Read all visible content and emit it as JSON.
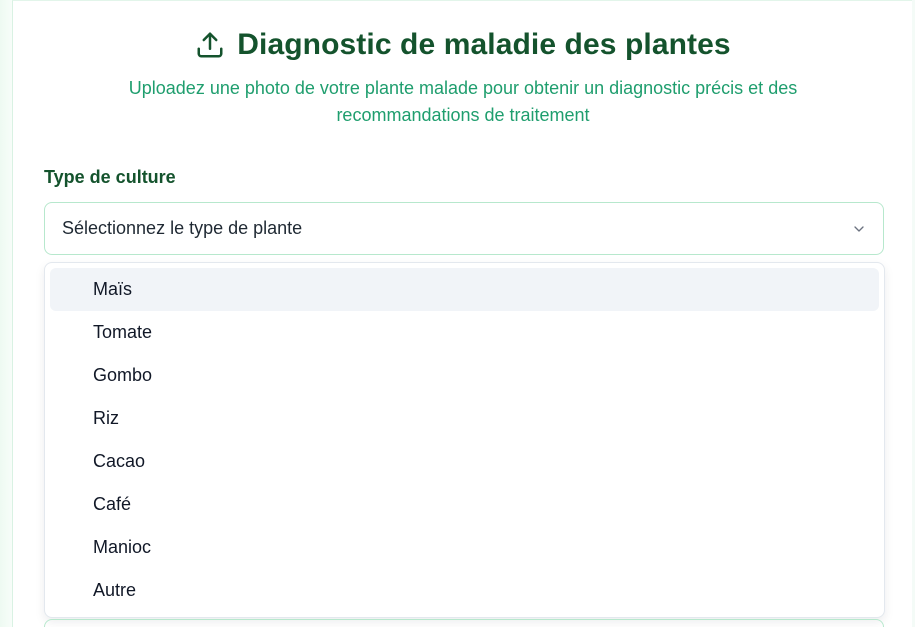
{
  "header": {
    "icon": "upload-icon",
    "title": "Diagnostic de maladie des plantes",
    "subtitle": "Uploadez une photo de votre plante malade pour obtenir un diagnostic précis et des recommandations de traitement"
  },
  "form": {
    "culture_label": "Type de culture",
    "culture_select": {
      "placeholder": "Sélectionnez le type de plante",
      "icon": "chevron-down-icon",
      "expanded": true,
      "highlighted_option": "Maïs",
      "options": [
        "Maïs",
        "Tomate",
        "Gombo",
        "Riz",
        "Cacao",
        "Café",
        "Manioc",
        "Autre"
      ]
    }
  },
  "colors": {
    "title": "#14532d",
    "subtitle": "#1f9e6e",
    "border": "#b7e8cd",
    "highlight": "#f1f4f8"
  }
}
